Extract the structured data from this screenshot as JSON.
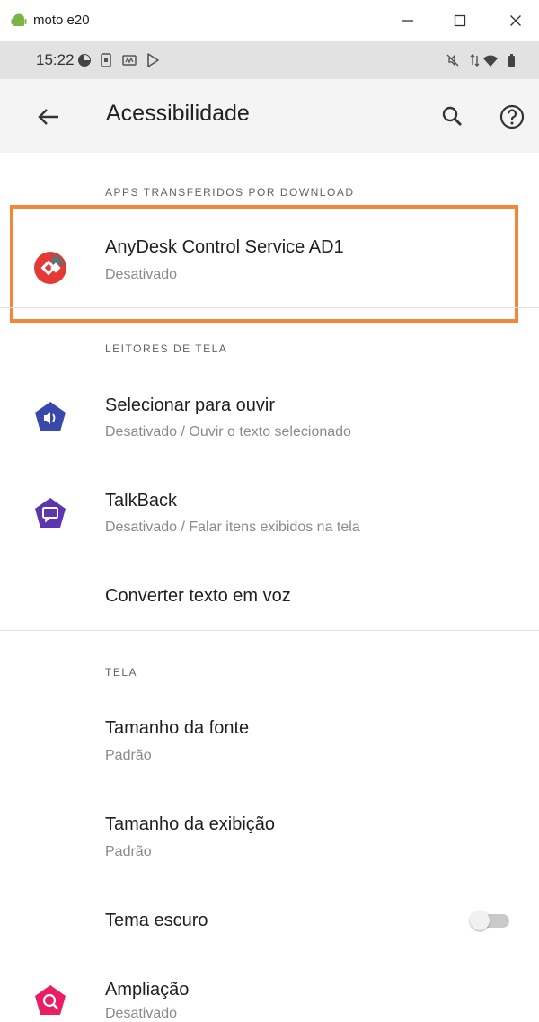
{
  "window": {
    "title": "moto e20"
  },
  "statusbar": {
    "time": "15:22"
  },
  "appbar": {
    "title": "Acessibilidade"
  },
  "sections": {
    "downloaded": "APPS TRANSFERIDOS POR DOWNLOAD",
    "screen_readers": "LEITORES DE TELA",
    "display": "TELA"
  },
  "items": {
    "anydesk": {
      "title": "AnyDesk Control Service AD1",
      "subtitle": "Desativado"
    },
    "select_to_speak": {
      "title": "Selecionar para ouvir",
      "subtitle": "Desativado / Ouvir o texto selecionado"
    },
    "talkback": {
      "title": "TalkBack",
      "subtitle": "Desativado / Falar itens exibidos na tela"
    },
    "tts": {
      "title": "Converter texto em voz"
    },
    "font_size": {
      "title": "Tamanho da fonte",
      "subtitle": "Padrão"
    },
    "display_size": {
      "title": "Tamanho da exibição",
      "subtitle": "Padrão"
    },
    "dark_theme": {
      "title": "Tema escuro",
      "enabled": false
    },
    "magnification": {
      "title": "Ampliação",
      "subtitle": "Desativado"
    }
  },
  "colors": {
    "highlight": "#f0883c",
    "anydesk": "#e53935",
    "select_to_speak": "#3949ab",
    "talkback": "#5e35b1",
    "magnification": "#e91e63"
  }
}
